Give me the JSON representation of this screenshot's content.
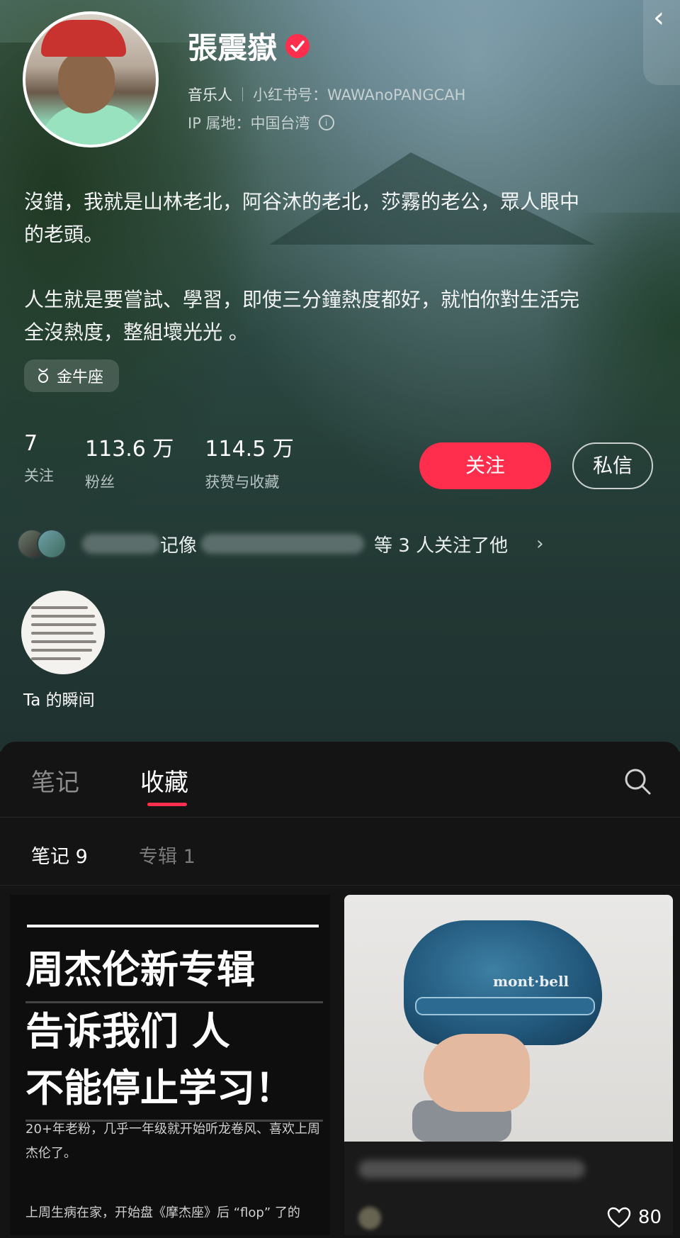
{
  "profile": {
    "name": "張震嶽",
    "role": "音乐人",
    "xhs_id": "小红书号：WAWAnoPANGCAH",
    "ip": "IP 属地：中国台湾",
    "bio": "沒錯，我就是山林老北，阿谷沐的老北，莎霧的老公，眾人眼中\n的老頭。\n\n人生就是要嘗試、學習，即使三分鐘熱度都好，就怕你對生活完\n全沒熱度，整組壞光光 。",
    "tag": "金牛座",
    "tag_icon": "taurus-icon"
  },
  "stats": [
    {
      "value": "7",
      "label": "关注"
    },
    {
      "value": "113.6 万",
      "label": "粉丝"
    },
    {
      "value": "114.5 万",
      "label": "获赞与收藏"
    }
  ],
  "buttons": {
    "follow": "关注",
    "message": "私信"
  },
  "mutual": {
    "partial_name": "记像",
    "text": "等 3 人关注了他",
    "chevron": "›"
  },
  "moments": {
    "label": "Ta 的瞬间"
  },
  "tabs": {
    "notes": "笔记",
    "favorites": "收藏"
  },
  "subtabs": {
    "notes": "笔记 9",
    "albums": "专辑 1"
  },
  "feed": {
    "card1": {
      "headline": [
        "周杰伦新专辑",
        "告诉我们 人",
        "不能停止学习！"
      ],
      "desc": "20+年老粉，几乎一年级就开始听龙卷风、喜欢上周杰伦了。",
      "desc2": "上周生病在家，开始盘《摩杰座》后 “flop” 了的"
    },
    "card2": {
      "logo_text": "mont·bell",
      "likes": "80"
    }
  },
  "colors": {
    "accent": "#ff2e4d"
  },
  "back_chevron": "‹"
}
